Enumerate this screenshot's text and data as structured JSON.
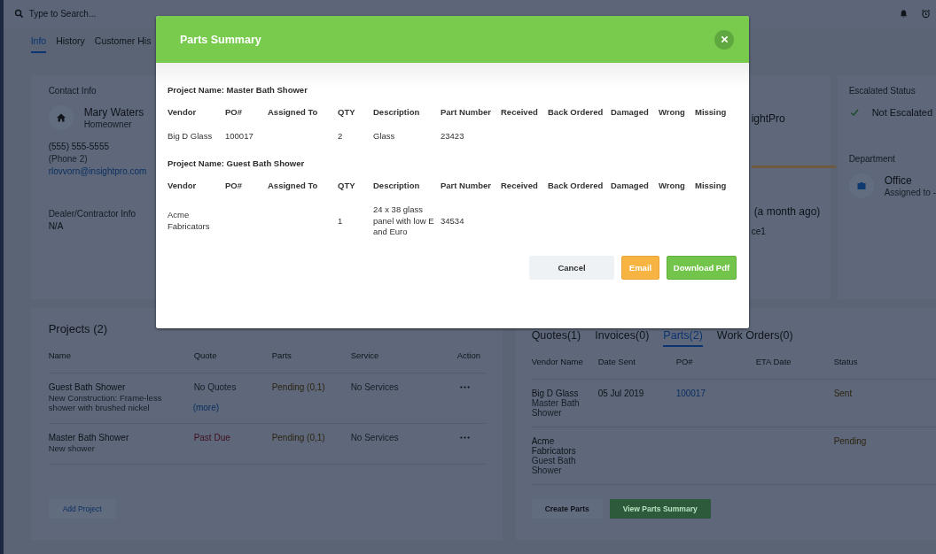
{
  "top_bar": {
    "search": {
      "placeholder": "Type to Search..."
    }
  },
  "tabs": [
    {
      "label": "Info",
      "selected": true
    },
    {
      "label": "History",
      "selected": false
    },
    {
      "label": "Customer His",
      "selected": false
    }
  ],
  "contact_info": {
    "heading": "Contact Info",
    "name": "Mary Waters",
    "role": "Homeowner",
    "phone": "(555) 555-5555",
    "phone_2": "(Phone 2)",
    "email": "rlovvorn@insightpro.com"
  },
  "dealer_info": {
    "heading": "Dealer/Contractor Info",
    "value": "N/A"
  },
  "middle_card": {
    "text_1": "ightPro",
    "text_2": "(a month ago)",
    "text_3": "ce1"
  },
  "escalated_status": {
    "heading": "Escalated Status",
    "value": "Not Escalated"
  },
  "department": {
    "heading": "Department",
    "value": "Office",
    "assigned": "Assigned to -"
  },
  "projects": {
    "title": "Projects (2)",
    "columns": [
      "Name",
      "Quote",
      "Parts",
      "Service",
      "Action"
    ],
    "rows": [
      {
        "name": "Guest Bath Shower",
        "description": "New Construction: Frame-less shower with brushed nickel",
        "more": "(more)",
        "quote": "No Quotes",
        "overdue": false,
        "parts": "Pending (0,1)",
        "service": "No Services"
      },
      {
        "name": "Master Bath Shower",
        "description": "New shower",
        "quote": "Past Due",
        "overdue": true,
        "parts": "Pending (0,1)",
        "service": "No Services"
      }
    ],
    "add_button": "Add Project"
  },
  "orders": {
    "tabs": [
      {
        "label": "Quotes(1)",
        "selected": false
      },
      {
        "label": "Invoices(0)",
        "selected": false
      },
      {
        "label": "Parts(2)",
        "selected": true
      },
      {
        "label": "Work Orders(0)",
        "selected": false
      }
    ],
    "columns": [
      "Vendor Name",
      "Date Sent",
      "PO#",
      "ETA Date",
      "Status"
    ],
    "rows": [
      {
        "vendor": "Big D Glass",
        "project": "Master Bath Shower",
        "date_sent": "05 Jul 2019",
        "po": "100017",
        "status": "Sent"
      },
      {
        "vendor": "Acme Fabricators",
        "project": "Guest Bath Shower",
        "status": "Pending"
      }
    ],
    "buttons": [
      {
        "label": "Create Parts",
        "kind": "plain"
      },
      {
        "label": "View Parts Summary",
        "kind": "primary"
      }
    ]
  },
  "modal": {
    "title": "Parts Summary",
    "projects": [
      {
        "label": "Project Name: Master Bath Shower",
        "columns": [
          "Vendor",
          "PO#",
          "Assigned To",
          "QTY",
          "Description",
          "Part Number",
          "Received",
          "Back Ordered",
          "Damaged",
          "Wrong",
          "Missing"
        ],
        "rows": [
          {
            "vendor": "Big D Glass",
            "po": "100017",
            "qty": "2",
            "description": "Glass",
            "part_number": "23423"
          }
        ]
      },
      {
        "label": "Project Name: Guest Bath Shower",
        "columns": [
          "Vendor",
          "PO#",
          "Assigned To",
          "QTY",
          "Description",
          "Part Number",
          "Received",
          "Back Ordered",
          "Damaged",
          "Wrong",
          "Missing"
        ],
        "rows": [
          {
            "vendor": "Acme Fabricators",
            "qty": "1",
            "description": "24 x 38 glass panel with low E and Euro",
            "part_number": "34534"
          }
        ]
      }
    ],
    "buttons": [
      {
        "label": "Cancel",
        "kind": "secondary"
      },
      {
        "label": "Email",
        "kind": "warning"
      },
      {
        "label": "Download Pdf",
        "kind": "success"
      }
    ]
  }
}
